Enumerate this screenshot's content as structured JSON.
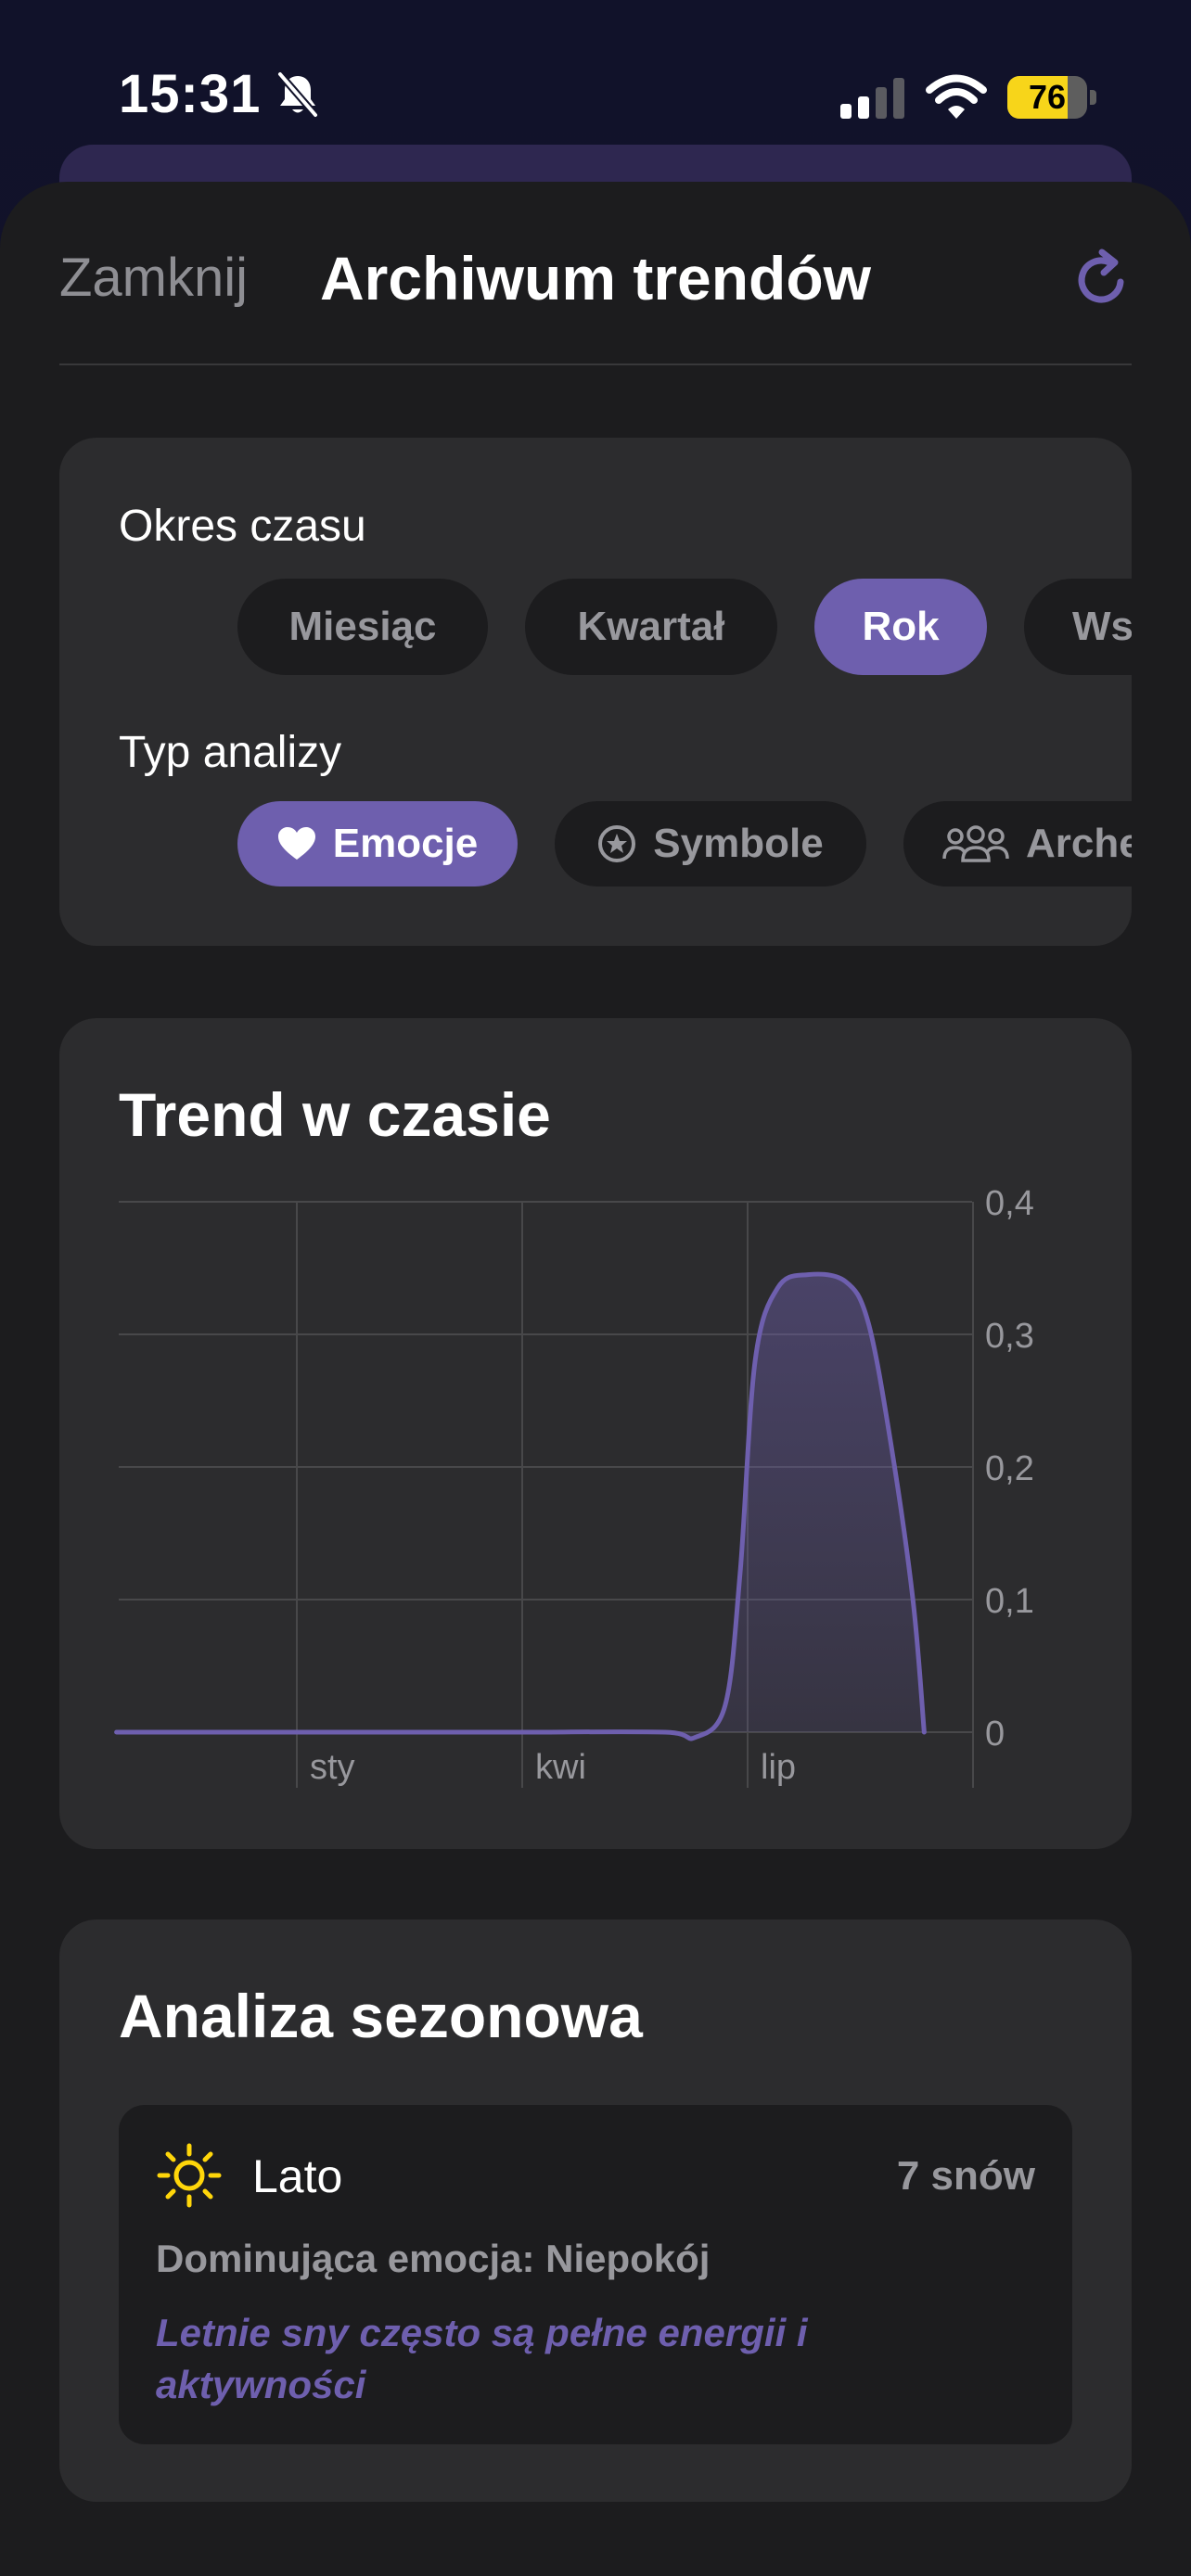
{
  "status_bar": {
    "time": "15:31",
    "battery": "76",
    "battery_level": 0.76
  },
  "nav": {
    "close_label": "Zamknij",
    "title": "Archiwum trendów"
  },
  "filters": {
    "period_label": "Okres czasu",
    "period_options": [
      "Miesiąc",
      "Kwartał",
      "Rok",
      "Ws"
    ],
    "period_selected": "Rok",
    "analysis_label": "Typ analizy",
    "analysis_options": [
      "Emocje",
      "Symbole",
      "Arche"
    ],
    "analysis_selected": "Emocje"
  },
  "trend": {
    "title": "Trend w czasie"
  },
  "chart_data": {
    "type": "area",
    "title": "Trend w czasie",
    "x_tick_labels": [
      "sty",
      "kwi",
      "lip"
    ],
    "y_tick_labels": [
      "0,4",
      "0,3",
      "0,2",
      "0,1",
      "0"
    ],
    "ylim": [
      0,
      0.4
    ],
    "grid": true,
    "y_axis_position": "right",
    "series": [
      {
        "color": "#6e5fae",
        "points": [
          {
            "m": -2.4,
            "v": 0
          },
          {
            "m": 0,
            "v": 0
          },
          {
            "m": 1,
            "v": 0
          },
          {
            "m": 2,
            "v": 0
          },
          {
            "m": 3,
            "v": 0
          },
          {
            "m": 4.9,
            "v": 0
          },
          {
            "m": 5.3,
            "v": -0.004
          },
          {
            "m": 5.7,
            "v": 0.02
          },
          {
            "m": 5.9,
            "v": 0.12
          },
          {
            "m": 6.1,
            "v": 0.28
          },
          {
            "m": 6.4,
            "v": 0.335
          },
          {
            "m": 6.8,
            "v": 0.345
          },
          {
            "m": 7.3,
            "v": 0.34
          },
          {
            "m": 7.6,
            "v": 0.31
          },
          {
            "m": 7.9,
            "v": 0.22
          },
          {
            "m": 8.2,
            "v": 0.1
          },
          {
            "m": 8.35,
            "v": 0
          }
        ]
      }
    ]
  },
  "seasonal": {
    "title": "Analiza sezonowa",
    "season_name": "Lato",
    "count": "7 snów",
    "dominant": "Dominująca emocja: Niepokój",
    "quote": "Letnie sny często są pełne energii i aktywności",
    "icon": "sun-icon",
    "icon_color": "#ffd60a"
  },
  "colors": {
    "accent": "#6e5fae",
    "card": "#2c2c2e",
    "sheet": "#1c1c1e"
  }
}
